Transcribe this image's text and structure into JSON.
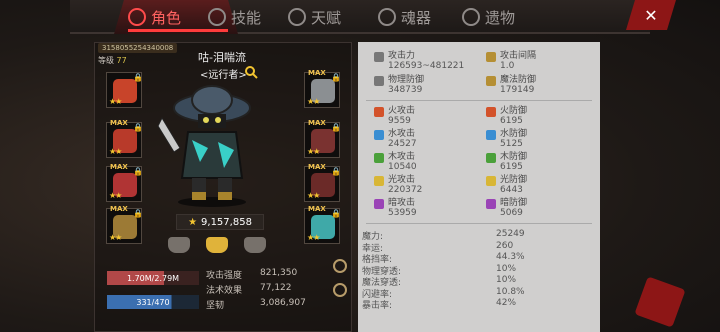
{
  "tabs": [
    {
      "label": "角色",
      "active": true,
      "icon": "character-icon"
    },
    {
      "label": "技能",
      "active": false,
      "icon": "skill-icon"
    },
    {
      "label": "天赋",
      "active": false,
      "icon": "talent-icon"
    },
    {
      "label": "魂器",
      "active": false,
      "icon": "soul-icon"
    },
    {
      "label": "遗物",
      "active": false,
      "icon": "relic-icon"
    }
  ],
  "close_label": "✕",
  "character": {
    "uid": "3158055254340008",
    "level_label": "等级",
    "level_value": "77",
    "name": "咕-泪喘流",
    "class": "<远行者>",
    "power": "9,157,858"
  },
  "equipment_left": [
    {
      "max": false,
      "stars": "★★",
      "color": "#c8442a"
    },
    {
      "max": true,
      "stars": "★★",
      "color": "#b83a2a"
    },
    {
      "max": true,
      "stars": "★★",
      "color": "#b03434"
    },
    {
      "max": true,
      "stars": "★★",
      "color": "#9c7a35"
    }
  ],
  "equipment_right": [
    {
      "max": true,
      "stars": "★★",
      "color": "#8b8f92"
    },
    {
      "max": true,
      "stars": "★★",
      "color": "#7a3230"
    },
    {
      "max": true,
      "stars": "★★",
      "color": "#6b2a28"
    },
    {
      "max": true,
      "stars": "★★",
      "color": "#3fa9a8"
    }
  ],
  "bars": {
    "hp": "1.70M/2.79M",
    "mp": "331/470"
  },
  "side_stats": [
    {
      "label": "攻击强度",
      "value": "821,350"
    },
    {
      "label": "法术效果",
      "value": "77,122"
    },
    {
      "label": "坚韧",
      "value": "3,086,907"
    }
  ],
  "stats_top": [
    {
      "label": "攻击力",
      "value": "126593~481221",
      "color": "#777"
    },
    {
      "label": "攻击间隔",
      "value": "1.0",
      "color": "#b58f34"
    },
    {
      "label": "物理防御",
      "value": "348739",
      "color": "#777"
    },
    {
      "label": "魔法防御",
      "value": "179149",
      "color": "#b58f34"
    }
  ],
  "stats_elem": [
    {
      "label": "火攻击",
      "value": "9559",
      "color": "#d3522a"
    },
    {
      "label": "火防御",
      "value": "6195",
      "color": "#d3522a"
    },
    {
      "label": "水攻击",
      "value": "24527",
      "color": "#3a8ed2"
    },
    {
      "label": "水防御",
      "value": "5125",
      "color": "#3a8ed2"
    },
    {
      "label": "木攻击",
      "value": "10540",
      "color": "#4aa03a"
    },
    {
      "label": "木防御",
      "value": "6195",
      "color": "#4aa03a"
    },
    {
      "label": "光攻击",
      "value": "220372",
      "color": "#d8b636"
    },
    {
      "label": "光防御",
      "value": "6443",
      "color": "#d8b636"
    },
    {
      "label": "暗攻击",
      "value": "53959",
      "color": "#9a44b6"
    },
    {
      "label": "暗防御",
      "value": "5069",
      "color": "#9a44b6"
    }
  ],
  "stats_misc": [
    {
      "label": "魔力:",
      "value": "25249"
    },
    {
      "label": "幸运:",
      "value": "260"
    },
    {
      "label": "格挡率:",
      "value": "44.3%"
    },
    {
      "label": "物理穿透:",
      "value": "10%"
    },
    {
      "label": "魔法穿透:",
      "value": "10%"
    },
    {
      "label": "闪避率:",
      "value": "10.8%"
    },
    {
      "label": "暴击率:",
      "value": "42%"
    }
  ]
}
